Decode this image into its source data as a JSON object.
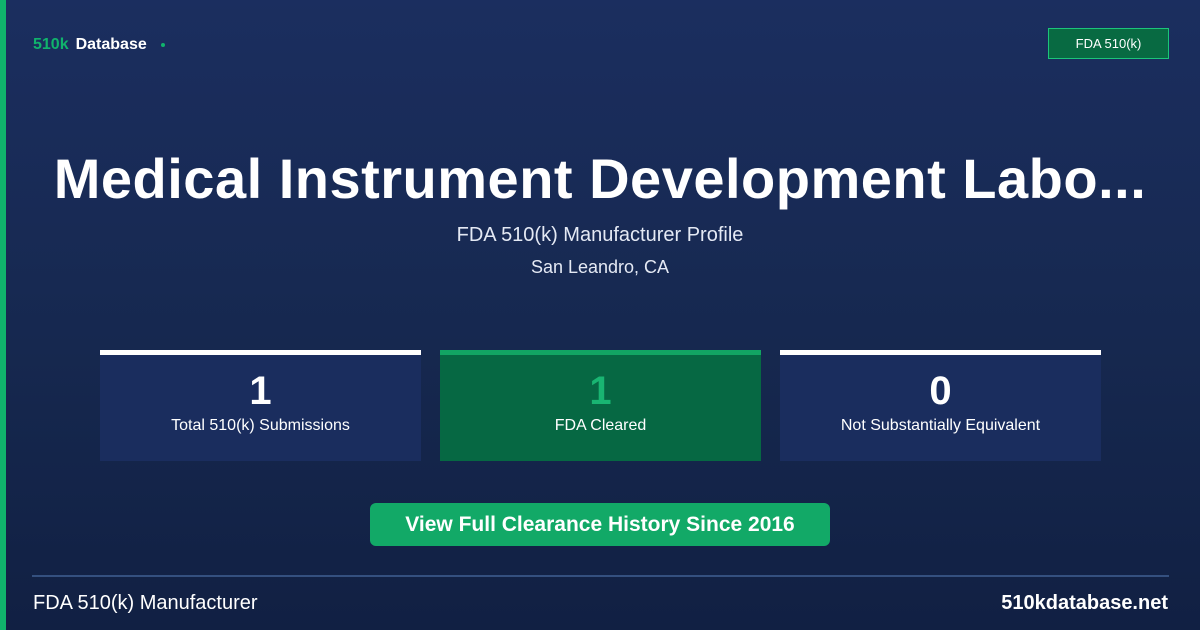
{
  "brand": {
    "accent": "510k",
    "name": "Database"
  },
  "badge": {
    "label": "FDA 510(k)"
  },
  "header": {
    "title": "Medical Instrument Development Labo...",
    "subtitle": "FDA 510(k) Manufacturer Profile",
    "location": "San Leandro, CA"
  },
  "stats": [
    {
      "value": "1",
      "label": "Total 510(k) Submissions"
    },
    {
      "value": "1",
      "label": "FDA Cleared"
    },
    {
      "value": "0",
      "label": "Not Substantially Equivalent"
    }
  ],
  "cta": {
    "label": "View Full Clearance History Since 2016"
  },
  "footer": {
    "left": "FDA 510(k) Manufacturer",
    "right": "510kdatabase.net"
  },
  "colors": {
    "accent": "#10b36c",
    "background": "#1b2e5f",
    "highlight": "#066843"
  }
}
